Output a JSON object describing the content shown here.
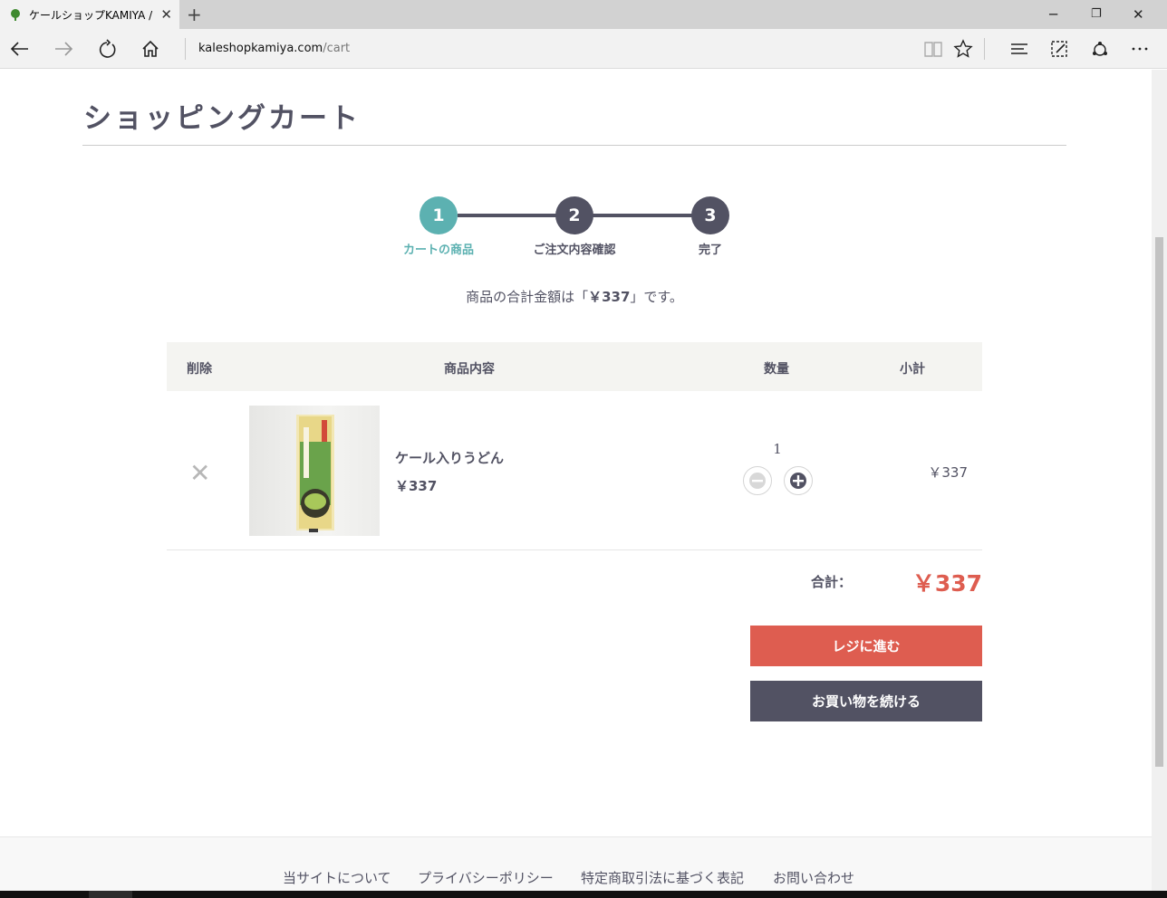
{
  "browser": {
    "tab_title": "ケールショップKAMIYA / 現",
    "url_host": "kaleshopkamiya.com",
    "url_path": "/cart"
  },
  "page": {
    "title": "ショッピングカート",
    "steps": [
      {
        "number": "1",
        "label": "カートの商品"
      },
      {
        "number": "2",
        "label": "ご注文内容確認"
      },
      {
        "number": "3",
        "label": "完了"
      }
    ],
    "total_message": {
      "prefix": "商品の合計金額は「",
      "amount": "￥337",
      "suffix": "」です。"
    },
    "table": {
      "headers": {
        "delete": "削除",
        "product": "商品内容",
        "quantity": "数量",
        "subtotal": "小計"
      },
      "items": [
        {
          "name": "ケール入りうどん",
          "price": "￥337",
          "quantity": "1",
          "subtotal": "￥337"
        }
      ]
    },
    "sum_label": "合計：",
    "sum_value": "￥337",
    "checkout_label": "レジに進む",
    "continue_label": "お買い物を続ける",
    "footer_links": [
      "当サイトについて",
      "プライバシーポリシー",
      "特定商取引法に基づく表記",
      "お問い合わせ"
    ]
  },
  "colors": {
    "accent_teal": "#5cb1b1",
    "accent_red": "#de5d50",
    "dark": "#525263"
  }
}
